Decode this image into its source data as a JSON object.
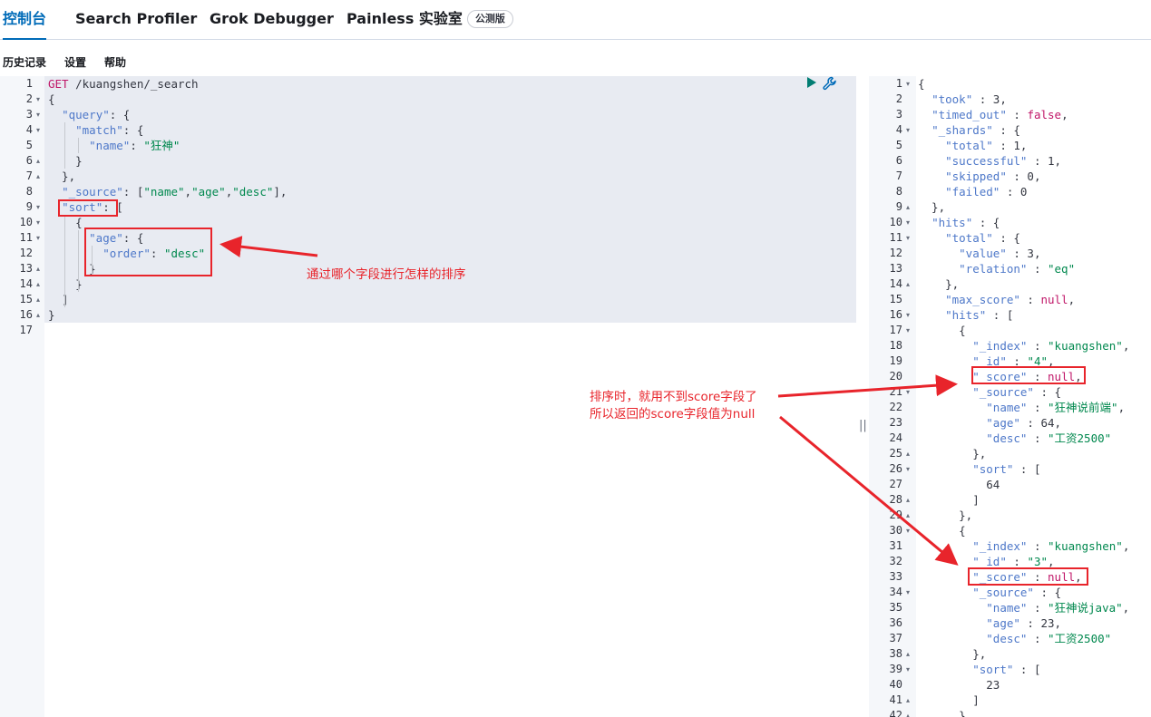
{
  "tabs": [
    "控制台",
    "Search Profiler",
    "Grok Debugger",
    "Painless 实验室"
  ],
  "beta_badge": "公测版",
  "menu": [
    "历史记录",
    "设置",
    "帮助"
  ],
  "colors": {
    "accent": "#006bb8",
    "annotation": "#e8242b",
    "key": "#4e78c9",
    "string": "#00884e",
    "method": "#c01668"
  },
  "request": {
    "line_numbers": [
      "1",
      "2",
      "3",
      "4",
      "5",
      "6",
      "7",
      "8",
      "9",
      "10",
      "11",
      "12",
      "13",
      "14",
      "15",
      "16",
      "17"
    ],
    "fold_markers": [
      "",
      "▾",
      "▾",
      "▾",
      "",
      "▴",
      "▴",
      "",
      "▾",
      "▾",
      "▾",
      "",
      "▴",
      "▴",
      "▴",
      "▴",
      ""
    ],
    "tokens": [
      [
        [
          "GET",
          "m"
        ],
        [
          " /kuangshen/_search",
          "n"
        ]
      ],
      [
        [
          "{",
          "p"
        ]
      ],
      [
        [
          "  ",
          "p"
        ],
        [
          "\"query\"",
          "k"
        ],
        [
          ": {",
          "p"
        ]
      ],
      [
        [
          "    ",
          "p"
        ],
        [
          "\"match\"",
          "k"
        ],
        [
          ": {",
          "p"
        ]
      ],
      [
        [
          "      ",
          "p"
        ],
        [
          "\"name\"",
          "k"
        ],
        [
          ": ",
          "p"
        ],
        [
          "\"狂神\"",
          "s"
        ]
      ],
      [
        [
          "    }",
          "p"
        ]
      ],
      [
        [
          "  },",
          "p"
        ]
      ],
      [
        [
          "  ",
          "p"
        ],
        [
          "\"_source\"",
          "k"
        ],
        [
          ": [",
          "p"
        ],
        [
          "\"name\"",
          "s"
        ],
        [
          ",",
          "p"
        ],
        [
          "\"age\"",
          "s"
        ],
        [
          ",",
          "p"
        ],
        [
          "\"desc\"",
          "s"
        ],
        [
          "],",
          "p"
        ]
      ],
      [
        [
          "  ",
          "p"
        ],
        [
          "\"sort\"",
          "k"
        ],
        [
          ": [",
          "p"
        ]
      ],
      [
        [
          "    {",
          "p"
        ]
      ],
      [
        [
          "      ",
          "p"
        ],
        [
          "\"age\"",
          "k"
        ],
        [
          ": {",
          "p"
        ]
      ],
      [
        [
          "        ",
          "p"
        ],
        [
          "\"order\"",
          "k"
        ],
        [
          ": ",
          "p"
        ],
        [
          "\"desc\"",
          "s"
        ]
      ],
      [
        [
          "      }",
          "p"
        ]
      ],
      [
        [
          "    }",
          "p"
        ]
      ],
      [
        [
          "  ]",
          "p"
        ]
      ],
      [
        [
          "}",
          "p"
        ]
      ],
      []
    ]
  },
  "response": {
    "line_numbers": [
      "1",
      "2",
      "3",
      "4",
      "5",
      "6",
      "7",
      "8",
      "9",
      "10",
      "11",
      "12",
      "13",
      "14",
      "15",
      "16",
      "17",
      "18",
      "19",
      "20",
      "21",
      "22",
      "23",
      "24",
      "25",
      "26",
      "27",
      "28",
      "29",
      "30",
      "31",
      "32",
      "33",
      "34",
      "35",
      "36",
      "37",
      "38",
      "39",
      "40",
      "41",
      "42"
    ],
    "fold_markers": [
      "▾",
      "",
      "",
      "▾",
      "",
      "",
      "",
      "",
      "▴",
      "▾",
      "▾",
      "",
      "",
      "▴",
      "",
      "▾",
      "▾",
      "",
      "",
      "",
      "▾",
      "",
      "",
      "",
      "▴",
      "▾",
      "",
      "▴",
      "▴",
      "▾",
      "",
      "",
      "",
      "▾",
      "",
      "",
      "",
      "▴",
      "▾",
      "",
      "▴",
      "▴"
    ],
    "tokens": [
      [
        [
          "{",
          "p"
        ]
      ],
      [
        [
          "  ",
          "p"
        ],
        [
          "\"took\"",
          "k"
        ],
        [
          " : ",
          "p"
        ],
        [
          "3",
          "n"
        ],
        [
          ",",
          "p"
        ]
      ],
      [
        [
          "  ",
          "p"
        ],
        [
          "\"timed_out\"",
          "k"
        ],
        [
          " : ",
          "p"
        ],
        [
          "false",
          "m"
        ],
        [
          ",",
          "p"
        ]
      ],
      [
        [
          "  ",
          "p"
        ],
        [
          "\"_shards\"",
          "k"
        ],
        [
          " : {",
          "p"
        ]
      ],
      [
        [
          "    ",
          "p"
        ],
        [
          "\"total\"",
          "k"
        ],
        [
          " : ",
          "p"
        ],
        [
          "1",
          "n"
        ],
        [
          ",",
          "p"
        ]
      ],
      [
        [
          "    ",
          "p"
        ],
        [
          "\"successful\"",
          "k"
        ],
        [
          " : ",
          "p"
        ],
        [
          "1",
          "n"
        ],
        [
          ",",
          "p"
        ]
      ],
      [
        [
          "    ",
          "p"
        ],
        [
          "\"skipped\"",
          "k"
        ],
        [
          " : ",
          "p"
        ],
        [
          "0",
          "n"
        ],
        [
          ",",
          "p"
        ]
      ],
      [
        [
          "    ",
          "p"
        ],
        [
          "\"failed\"",
          "k"
        ],
        [
          " : ",
          "p"
        ],
        [
          "0",
          "n"
        ]
      ],
      [
        [
          "  },",
          "p"
        ]
      ],
      [
        [
          "  ",
          "p"
        ],
        [
          "\"hits\"",
          "k"
        ],
        [
          " : {",
          "p"
        ]
      ],
      [
        [
          "    ",
          "p"
        ],
        [
          "\"total\"",
          "k"
        ],
        [
          " : {",
          "p"
        ]
      ],
      [
        [
          "      ",
          "p"
        ],
        [
          "\"value\"",
          "k"
        ],
        [
          " : ",
          "p"
        ],
        [
          "3",
          "n"
        ],
        [
          ",",
          "p"
        ]
      ],
      [
        [
          "      ",
          "p"
        ],
        [
          "\"relation\"",
          "k"
        ],
        [
          " : ",
          "p"
        ],
        [
          "\"eq\"",
          "s"
        ]
      ],
      [
        [
          "    },",
          "p"
        ]
      ],
      [
        [
          "    ",
          "p"
        ],
        [
          "\"max_score\"",
          "k"
        ],
        [
          " : ",
          "p"
        ],
        [
          "null",
          "m"
        ],
        [
          ",",
          "p"
        ]
      ],
      [
        [
          "    ",
          "p"
        ],
        [
          "\"hits\"",
          "k"
        ],
        [
          " : [",
          "p"
        ]
      ],
      [
        [
          "      {",
          "p"
        ]
      ],
      [
        [
          "        ",
          "p"
        ],
        [
          "\"_index\"",
          "k"
        ],
        [
          " : ",
          "p"
        ],
        [
          "\"kuangshen\"",
          "s"
        ],
        [
          ",",
          "p"
        ]
      ],
      [
        [
          "        ",
          "p"
        ],
        [
          "\"_id\"",
          "k"
        ],
        [
          " : ",
          "p"
        ],
        [
          "\"4\"",
          "s"
        ],
        [
          ",",
          "p"
        ]
      ],
      [
        [
          "        ",
          "p"
        ],
        [
          "\"_score\"",
          "k"
        ],
        [
          " : ",
          "p"
        ],
        [
          "null",
          "m"
        ],
        [
          ",",
          "p"
        ]
      ],
      [
        [
          "        ",
          "p"
        ],
        [
          "\"_source\"",
          "k"
        ],
        [
          " : {",
          "p"
        ]
      ],
      [
        [
          "          ",
          "p"
        ],
        [
          "\"name\"",
          "k"
        ],
        [
          " : ",
          "p"
        ],
        [
          "\"狂神说前端\"",
          "s"
        ],
        [
          ",",
          "p"
        ]
      ],
      [
        [
          "          ",
          "p"
        ],
        [
          "\"age\"",
          "k"
        ],
        [
          " : ",
          "p"
        ],
        [
          "64",
          "n"
        ],
        [
          ",",
          "p"
        ]
      ],
      [
        [
          "          ",
          "p"
        ],
        [
          "\"desc\"",
          "k"
        ],
        [
          " : ",
          "p"
        ],
        [
          "\"工资2500\"",
          "s"
        ]
      ],
      [
        [
          "        },",
          "p"
        ]
      ],
      [
        [
          "        ",
          "p"
        ],
        [
          "\"sort\"",
          "k"
        ],
        [
          " : [",
          "p"
        ]
      ],
      [
        [
          "          ",
          "p"
        ],
        [
          "64",
          "n"
        ]
      ],
      [
        [
          "        ]",
          "p"
        ]
      ],
      [
        [
          "      },",
          "p"
        ]
      ],
      [
        [
          "      {",
          "p"
        ]
      ],
      [
        [
          "        ",
          "p"
        ],
        [
          "\"_index\"",
          "k"
        ],
        [
          " : ",
          "p"
        ],
        [
          "\"kuangshen\"",
          "s"
        ],
        [
          ",",
          "p"
        ]
      ],
      [
        [
          "        ",
          "p"
        ],
        [
          "\"_id\"",
          "k"
        ],
        [
          " : ",
          "p"
        ],
        [
          "\"3\"",
          "s"
        ],
        [
          ",",
          "p"
        ]
      ],
      [
        [
          "        ",
          "p"
        ],
        [
          "\"_score\"",
          "k"
        ],
        [
          " : ",
          "p"
        ],
        [
          "null",
          "m"
        ],
        [
          ",",
          "p"
        ]
      ],
      [
        [
          "        ",
          "p"
        ],
        [
          "\"_source\"",
          "k"
        ],
        [
          " : {",
          "p"
        ]
      ],
      [
        [
          "          ",
          "p"
        ],
        [
          "\"name\"",
          "k"
        ],
        [
          " : ",
          "p"
        ],
        [
          "\"狂神说java\"",
          "s"
        ],
        [
          ",",
          "p"
        ]
      ],
      [
        [
          "          ",
          "p"
        ],
        [
          "\"age\"",
          "k"
        ],
        [
          " : ",
          "p"
        ],
        [
          "23",
          "n"
        ],
        [
          ",",
          "p"
        ]
      ],
      [
        [
          "          ",
          "p"
        ],
        [
          "\"desc\"",
          "k"
        ],
        [
          " : ",
          "p"
        ],
        [
          "\"工资2500\"",
          "s"
        ]
      ],
      [
        [
          "        },",
          "p"
        ]
      ],
      [
        [
          "        ",
          "p"
        ],
        [
          "\"sort\"",
          "k"
        ],
        [
          " : [",
          "p"
        ]
      ],
      [
        [
          "          ",
          "p"
        ],
        [
          "23",
          "n"
        ]
      ],
      [
        [
          "        ]",
          "p"
        ]
      ],
      [
        [
          "      },",
          "p"
        ]
      ]
    ]
  },
  "annotations": {
    "sort_note": "通过哪个字段进行怎样的排序",
    "score_note_line1": "排序时，就用不到score字段了",
    "score_note_line2": "所以返回的score字段值为null"
  }
}
